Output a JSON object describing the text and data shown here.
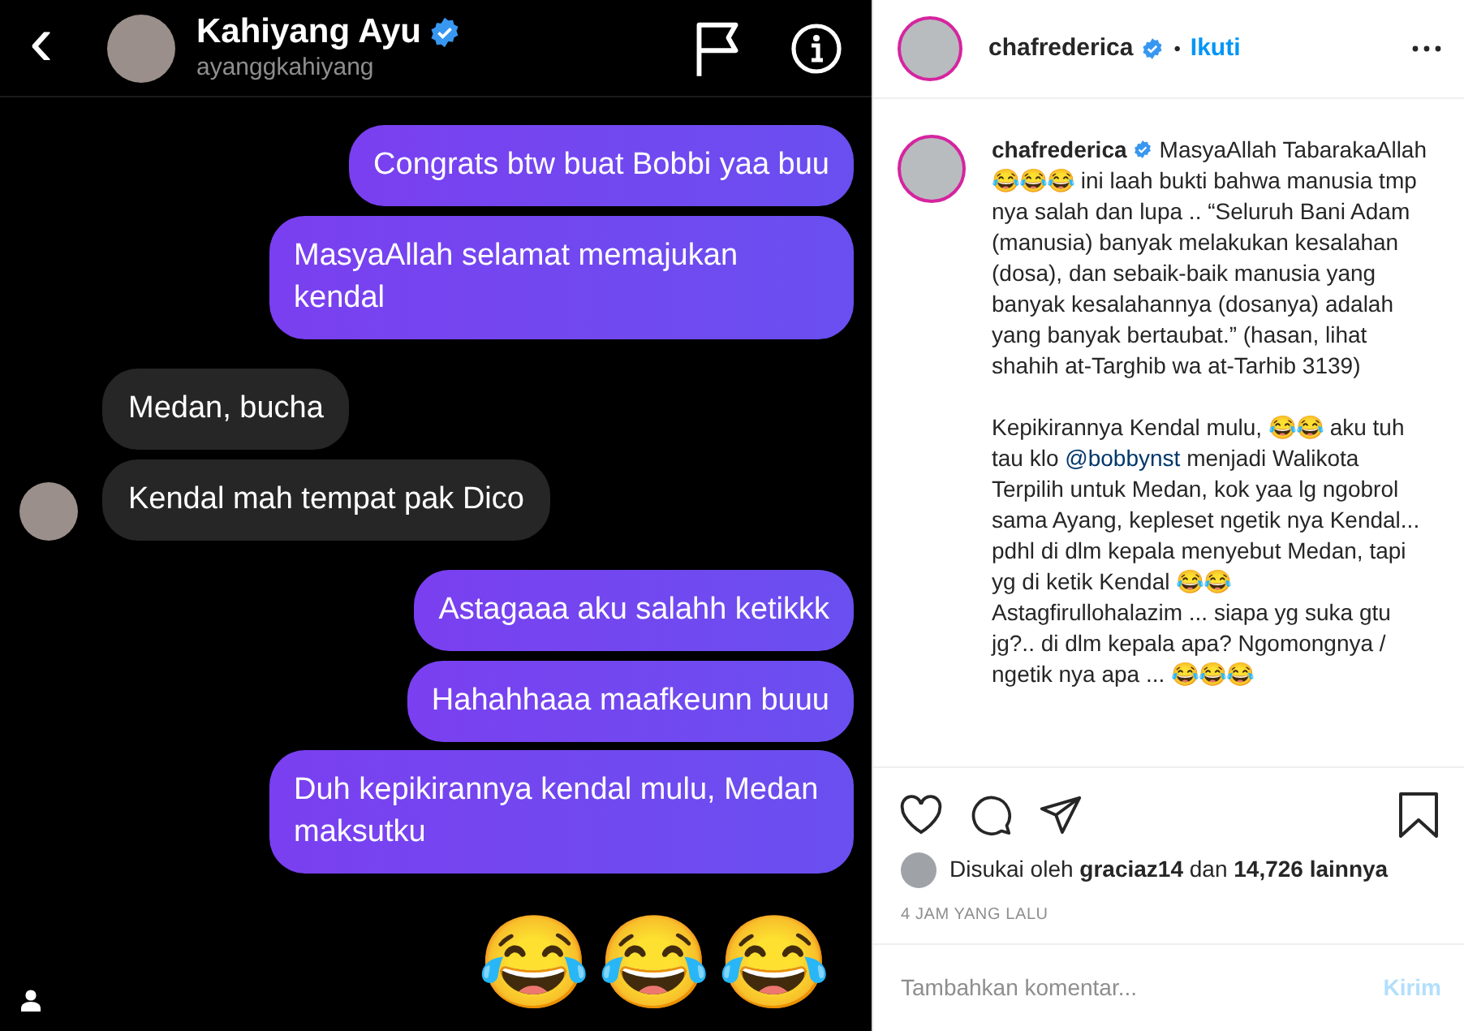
{
  "chat": {
    "back": "‹",
    "name": "Kahiyang Ayu",
    "verified": true,
    "username": "ayanggkahiyang",
    "messages": [
      {
        "kind": "sent",
        "text": "Congrats btw buat Bobbi yaa buu"
      },
      {
        "kind": "sent",
        "text": "MasyaAllah selamat memajukan kendal"
      },
      {
        "kind": "received",
        "text": "Medan, bucha",
        "show_avatar": false
      },
      {
        "kind": "received",
        "text": "Kendal mah tempat pak Dico",
        "show_avatar": true
      },
      {
        "kind": "sent",
        "text": "Astagaaa aku salahh ketikkk"
      },
      {
        "kind": "sent",
        "text": "Hahahhaaa maafkeunn buuu"
      },
      {
        "kind": "sent",
        "text": "Duh kepikirannya kendal mulu, Medan maksutku"
      },
      {
        "kind": "emoji",
        "text": "😂😂😂"
      }
    ]
  },
  "post": {
    "username": "chafrederica",
    "verified": true,
    "separator": "•",
    "follow": "Ikuti",
    "caption": {
      "username": "chafrederica",
      "paragraphs": [
        [
          {
            "kind": "text",
            "text": "MasyaAllah TabarakaAllah 😂😂😂 ini laah bukti bahwa manusia tmp nya salah dan lupa .. “Seluruh Bani Adam (manusia) banyak melakukan kesalahan (dosa), dan sebaik-baik manusia yang banyak kesalahannya (dosanya) adalah yang banyak bertaubat.” (hasan, lihat shahih at-Targhib wa at-Tarhib 3139)"
          }
        ],
        [
          {
            "kind": "text",
            "text": "Kepikirannya Kendal mulu, 😂😂 aku tuh tau klo "
          },
          {
            "kind": "mention",
            "text": "@bobbynst"
          },
          {
            "kind": "text",
            "text": " menjadi Walikota Terpilih untuk Medan, kok yaa lg ngobrol sama Ayang, kepleset ngetik nya Kendal... pdhl di dlm kepala menyebut Medan, tapi yg di ketik Kendal 😂😂 Astagfirullohalazim ... siapa yg suka gtu jg?.. di dlm kepala apa? Ngomongnya / ngetik nya apa ... 😂😂😂"
          }
        ]
      ]
    },
    "likes": "Disukai oleh **graciaz14** dan **14,726 lainnya**",
    "time": "4 JAM YANG LALU",
    "comment": {
      "placeholder": "Tambahkan komentar...",
      "submit": "Kirim",
      "submit_disabled": true
    }
  }
}
